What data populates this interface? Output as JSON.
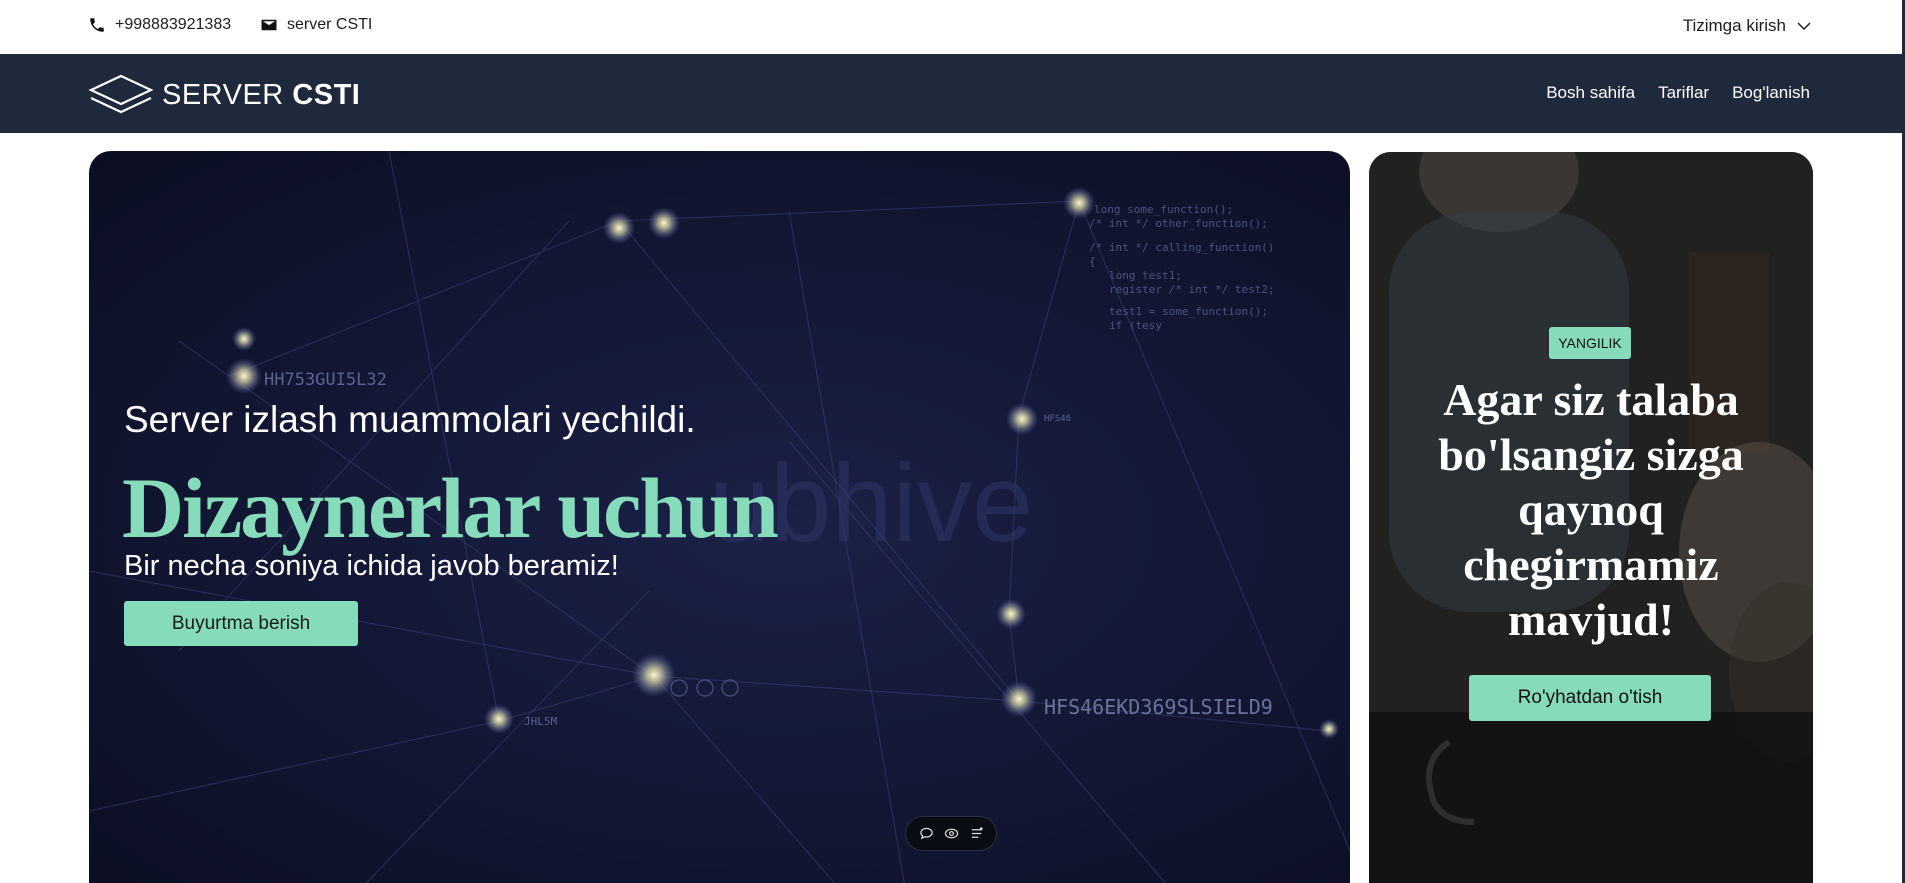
{
  "topbar": {
    "phone": "+998883921383",
    "email_label": "server CSTI",
    "login_label": "Tizimga kirish",
    "icons": [
      "phone-icon",
      "mail-icon",
      "chevron-down-icon"
    ]
  },
  "nav": {
    "logo_word1": "SERVER",
    "logo_word2": "CSTI",
    "items": [
      {
        "label": "Bosh sahifa"
      },
      {
        "label": "Tariflar"
      },
      {
        "label": "Bog'lanish"
      }
    ],
    "background": "#1e293b"
  },
  "hero": {
    "subheading": "Server izlash muammolari yechildi.",
    "headline": "Dizaynerlar uchun",
    "subtext": "Bir necha soniya ichida javob beramiz!",
    "button_label": "Buyurtma berish",
    "accent_color": "#86dcba",
    "chat_icons": [
      "chat-bubble-icon",
      "eye-icon",
      "menu-lines-icon"
    ]
  },
  "promo": {
    "badge": "YANGILIK",
    "title": "Agar siz talaba bo'lsangiz sizga qaynoq chegirmamiz mavjud!",
    "button_label": "Ro'yhatdan o'tish"
  }
}
